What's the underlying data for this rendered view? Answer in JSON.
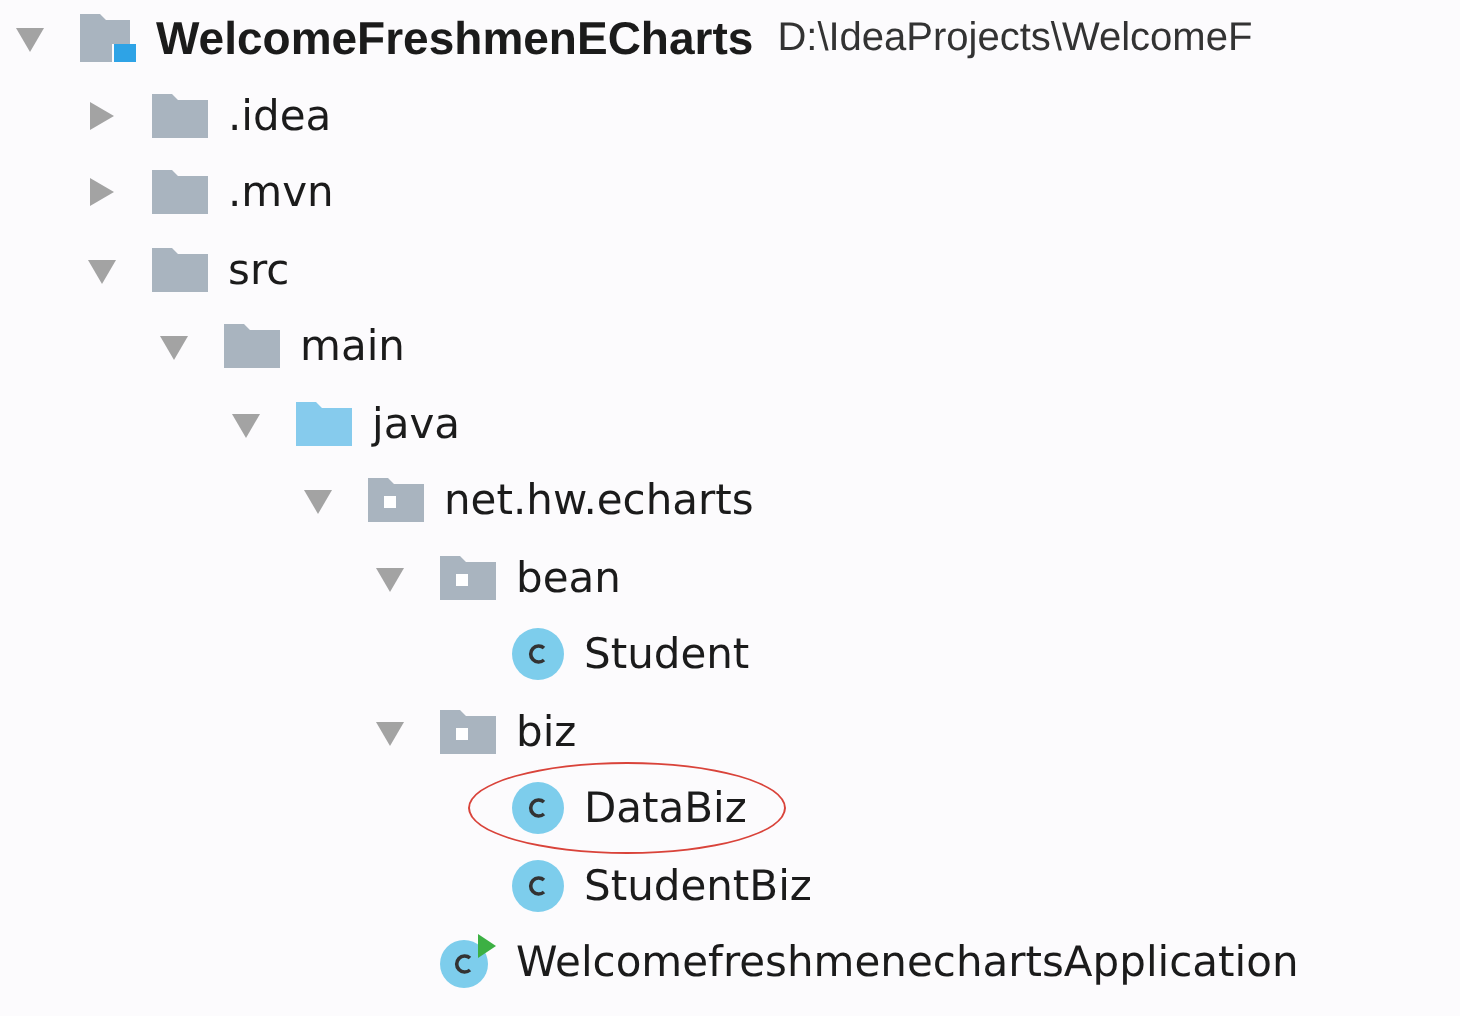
{
  "project_tree": [
    {
      "kind": "project",
      "label": "WelcomeFreshmenECharts",
      "path": "D:\\IdeaProjects\\WelcomeF",
      "expanded": true,
      "circled": false,
      "children": [
        {
          "kind": "folder",
          "label": ".idea",
          "expanded": false,
          "circled": false
        },
        {
          "kind": "folder",
          "label": ".mvn",
          "expanded": false,
          "circled": false
        },
        {
          "kind": "folder",
          "label": "src",
          "expanded": true,
          "circled": false,
          "children": [
            {
              "kind": "folder",
              "label": "main",
              "expanded": true,
              "circled": false,
              "children": [
                {
                  "kind": "source-folder",
                  "label": "java",
                  "expanded": true,
                  "circled": false,
                  "children": [
                    {
                      "kind": "package",
                      "label": "net.hw.echarts",
                      "expanded": true,
                      "circled": false,
                      "children": [
                        {
                          "kind": "package",
                          "label": "bean",
                          "expanded": true,
                          "circled": false,
                          "children": [
                            {
                              "kind": "class",
                              "label": "Student",
                              "circled": false
                            }
                          ]
                        },
                        {
                          "kind": "package",
                          "label": "biz",
                          "expanded": true,
                          "circled": false,
                          "children": [
                            {
                              "kind": "class",
                              "label": "DataBiz",
                              "circled": true
                            },
                            {
                              "kind": "class",
                              "label": "StudentBiz",
                              "circled": false
                            }
                          ]
                        },
                        {
                          "kind": "app-class",
                          "label": "WelcomefreshmenechartsApplication",
                          "circled": false
                        }
                      ]
                    }
                  ]
                }
              ]
            }
          ]
        }
      ]
    }
  ]
}
